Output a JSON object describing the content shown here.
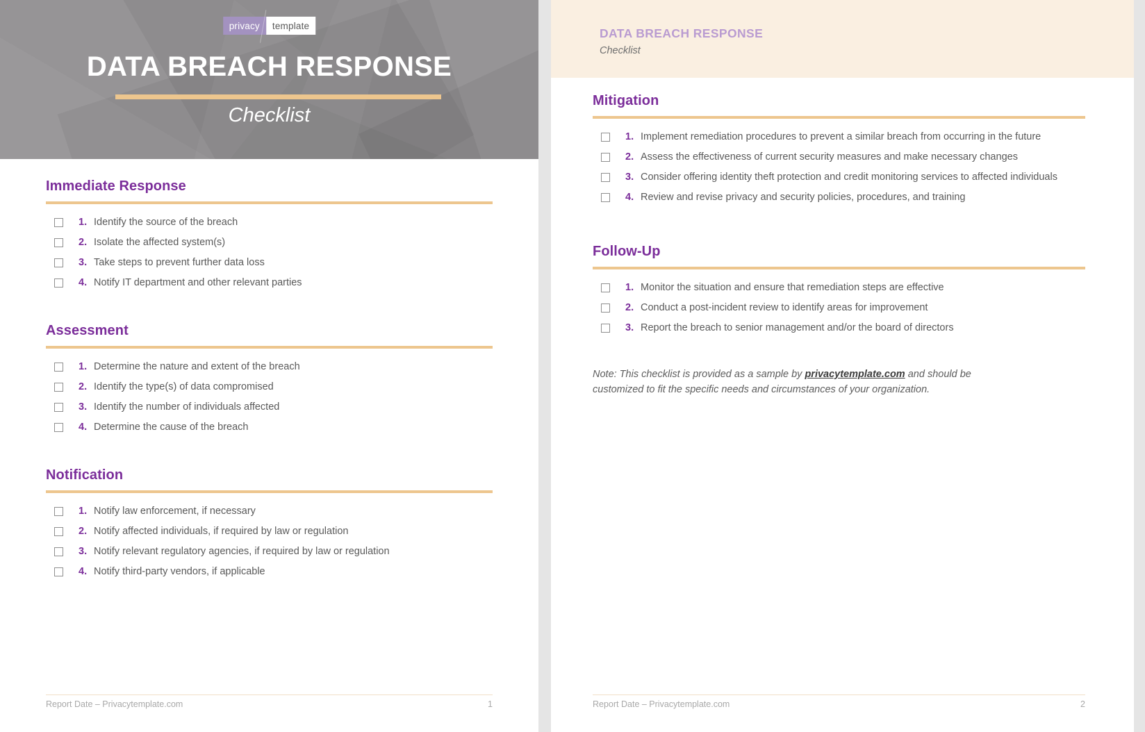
{
  "document": {
    "title": "DATA BREACH RESPONSE",
    "subtitle": "Checklist"
  },
  "brand": {
    "logo_left": "privacy",
    "logo_right": "template",
    "accent_purple": "#7b2d9a",
    "accent_gold": "#edc68e",
    "band_bg": "#faefe1",
    "cover_bg": "#929092",
    "header_purple": "#b99bd1"
  },
  "page1": {
    "cover": {
      "title": "DATA BREACH RESPONSE",
      "subtitle": "Checklist"
    },
    "sections": [
      {
        "heading": "Immediate Response",
        "items": [
          {
            "num": "1.",
            "text": "Identify the source of the breach"
          },
          {
            "num": "2.",
            "text": "Isolate the affected system(s)"
          },
          {
            "num": "3.",
            "text": "Take steps to prevent further data loss"
          },
          {
            "num": "4.",
            "text": "Notify IT department and other relevant parties"
          }
        ]
      },
      {
        "heading": "Assessment",
        "items": [
          {
            "num": "1.",
            "text": "Determine the nature and extent of the breach"
          },
          {
            "num": "2.",
            "text": "Identify the type(s) of data compromised"
          },
          {
            "num": "3.",
            "text": "Identify the number of individuals affected"
          },
          {
            "num": "4.",
            "text": "Determine the cause of the breach"
          }
        ]
      },
      {
        "heading": "Notification",
        "items": [
          {
            "num": "1.",
            "text": "Notify law enforcement, if necessary"
          },
          {
            "num": "2.",
            "text": "Notify affected individuals, if required by law or regulation"
          },
          {
            "num": "3.",
            "text": "Notify relevant regulatory agencies, if required by law or regulation"
          },
          {
            "num": "4.",
            "text": "Notify third-party vendors, if applicable"
          }
        ]
      }
    ],
    "footer": {
      "left": "Report Date – Privacytemplate.com",
      "page_number": "1"
    }
  },
  "page2": {
    "header": {
      "title": "DATA BREACH RESPONSE",
      "subtitle": "Checklist"
    },
    "sections": [
      {
        "heading": "Mitigation",
        "items": [
          {
            "num": "1.",
            "text": "Implement remediation procedures to prevent a similar breach from occurring in the future"
          },
          {
            "num": "2.",
            "text": "Assess the effectiveness of current security measures and make necessary changes"
          },
          {
            "num": "3.",
            "text": "Consider offering identity theft protection and credit monitoring services to affected individuals"
          },
          {
            "num": "4.",
            "text": "Review and revise privacy and security policies, procedures, and training"
          }
        ]
      },
      {
        "heading": "Follow-Up",
        "items": [
          {
            "num": "1.",
            "text": "Monitor the situation and ensure that remediation steps are effective"
          },
          {
            "num": "2.",
            "text": "Conduct a post-incident review to identify areas for improvement"
          },
          {
            "num": "3.",
            "text": "Report the breach to senior management and/or the board of directors"
          }
        ]
      }
    ],
    "note": {
      "before": "Note: This checklist is provided as a sample by ",
      "link": "privacytemplate.com",
      "after": " and should be customized to fit the specific needs and circumstances of your organization."
    },
    "footer": {
      "left": "Report Date – Privacytemplate.com",
      "page_number": "2"
    }
  }
}
